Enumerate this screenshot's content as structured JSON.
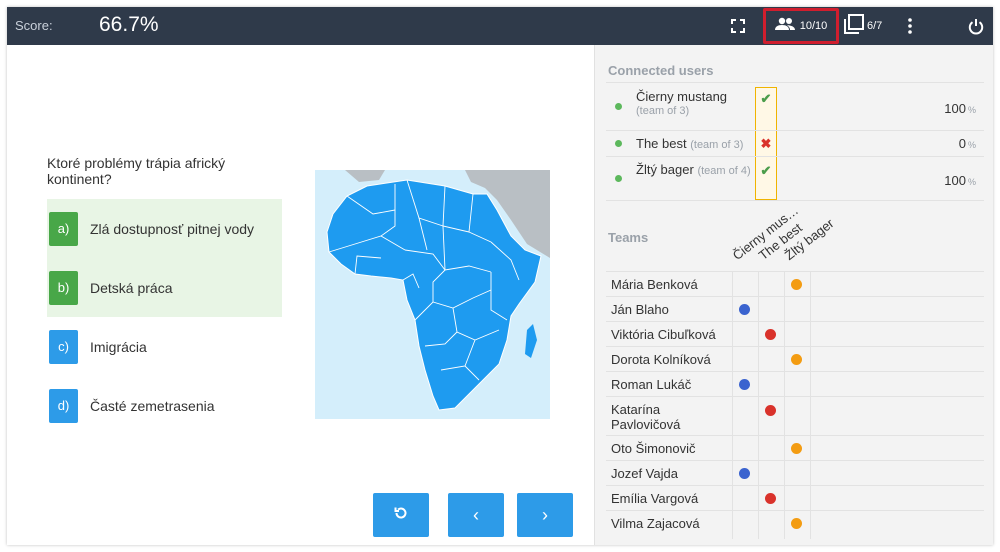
{
  "topbar": {
    "score_label": "Score:",
    "score_value": "66.7%",
    "users_count": "10/10",
    "slides_count": "6/7",
    "icons": [
      "fullscreen-icon",
      "users-icon",
      "slides-icon",
      "more-vert-icon",
      "power-icon"
    ]
  },
  "question": {
    "text": "Ktoré problémy trápia africký kontinent?",
    "answers": [
      {
        "letter": "a)",
        "text": "Zlá dostupnosť pitnej vody",
        "state": "correct"
      },
      {
        "letter": "b)",
        "text": "Detská práca",
        "state": "correct"
      },
      {
        "letter": "c)",
        "text": "Imigrácia",
        "state": "neutral"
      },
      {
        "letter": "d)",
        "text": "Časté zemetrasenia",
        "state": "neutral"
      }
    ]
  },
  "nav": {
    "icons": [
      "reset-icon",
      "previous-icon",
      "next-icon"
    ],
    "prev_glyph": "‹",
    "next_glyph": "›"
  },
  "connected": {
    "title": "Connected users",
    "users": [
      {
        "name": "Čierny mustang",
        "team": "(team of 3)",
        "mark": "✔",
        "result": "ok",
        "pct": "100",
        "unit": "%"
      },
      {
        "name": "The best",
        "team": "(team of 3)",
        "mark": "✖",
        "result": "bad",
        "pct": "0",
        "unit": "%"
      },
      {
        "name": "Žltý bager",
        "team": "(team of 4)",
        "mark": "✔",
        "result": "ok",
        "pct": "100",
        "unit": "%"
      }
    ]
  },
  "teams": {
    "title": "Teams",
    "columns": [
      "Čierny mus…",
      "The best",
      "Žltý bager"
    ],
    "colors": {
      "team1": "#3a63cf",
      "team2": "#d9322b",
      "team3": "#f39c12"
    },
    "members": [
      {
        "name": "Mária Benková",
        "team": 3
      },
      {
        "name": "Ján Blaho",
        "team": 1
      },
      {
        "name": "Viktória Cibuľková",
        "team": 2
      },
      {
        "name": "Dorota Kolníková",
        "team": 3
      },
      {
        "name": "Roman Lukáč",
        "team": 1
      },
      {
        "name": "Katarína Pavlovičová",
        "team": 2
      },
      {
        "name": "Oto Šimonovič",
        "team": 3
      },
      {
        "name": "Jozef Vajda",
        "team": 1
      },
      {
        "name": "Emília Vargová",
        "team": 2
      },
      {
        "name": "Vilma Zajacová",
        "team": 3
      }
    ]
  },
  "colors": {
    "topbar": "#2f3a4a",
    "accent_blue": "#2d9be8",
    "correct_green": "#48a748",
    "highlight_red": "#d01e2e",
    "highlight_yellow": "#f0b400"
  }
}
